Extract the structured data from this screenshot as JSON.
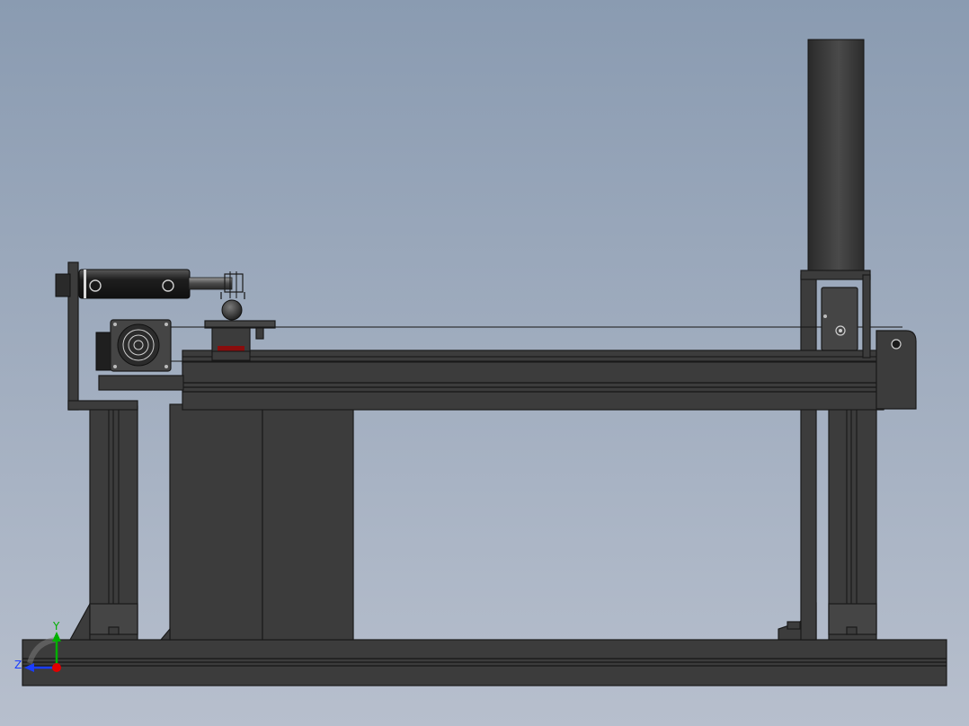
{
  "colors": {
    "background_top": "#8a9bb1",
    "background_bottom": "#b7bfcd",
    "part_fill": "#3c3c3c",
    "edge": "#1a1a1a",
    "axis_x": "#e00000",
    "axis_y": "#00b000",
    "axis_z": "#1a3dff",
    "accent_red": "#8a0d0d"
  },
  "triad": {
    "y_label": "Y",
    "z_label": "Z"
  }
}
